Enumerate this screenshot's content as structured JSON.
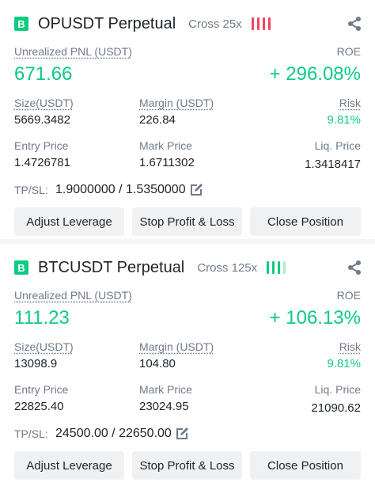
{
  "positions": [
    {
      "badge": "B",
      "symbol": "OPUSDT Perpetual",
      "cross": "Cross 25x",
      "risk_bar_color": "#f6465d",
      "pnl_label": "Unrealized PNL (USDT)",
      "pnl_value": "671.66",
      "roe_label": "ROE",
      "roe_value": "+ 296.08%",
      "size_label": "Size(USDT)",
      "size_value": "5669.3482",
      "margin_label": "Margin (USDT)",
      "margin_value": "226.84",
      "risk_label": "Risk",
      "risk_value": "9.81%",
      "entry_label": "Entry Price",
      "entry_value": "1.4726781",
      "mark_label": "Mark Price",
      "mark_value": "1.6711302",
      "liq_label": "Liq. Price",
      "liq_value": "1.3418417",
      "tpsl_label": "TP/SL:",
      "tpsl_value": "1.9000000 / 1.5350000",
      "buttons": [
        "Adjust Leverage",
        "Stop Profit & Loss",
        "Close Position"
      ]
    },
    {
      "badge": "B",
      "symbol": "BTCUSDT Perpetual",
      "cross": "Cross 125x",
      "risk_bar_color": "#0ecb81",
      "pnl_label": "Unrealized PNL (USDT)",
      "pnl_value": "111.23",
      "roe_label": "ROE",
      "roe_value": "+ 106.13%",
      "size_label": "Size(USDT)",
      "size_value": "13098.9",
      "margin_label": "Margin (USDT)",
      "margin_value": "104.80",
      "risk_label": "Risk",
      "risk_value": "9.81%",
      "entry_label": "Entry Price",
      "entry_value": "22825.40",
      "mark_label": "Mark Price",
      "mark_value": "23024.95",
      "liq_label": "Liq. Price",
      "liq_value": "21090.62",
      "tpsl_label": "TP/SL:",
      "tpsl_value": "24500.00 / 22650.00",
      "buttons": [
        "Adjust Leverage",
        "Stop Profit & Loss",
        "Close Position"
      ]
    }
  ],
  "icons": {
    "share": "share-icon",
    "edit": "edit-icon"
  }
}
